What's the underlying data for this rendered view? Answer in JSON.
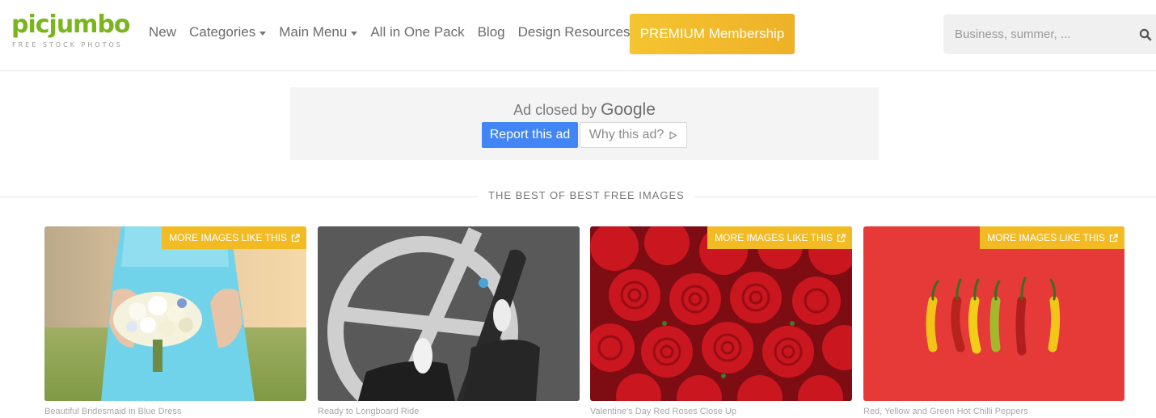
{
  "brand": {
    "name": "picjumbo",
    "tagline": "FREE STOCK PHOTOS",
    "color": "#7ab51d"
  },
  "nav": {
    "items": [
      {
        "label": "New",
        "has_caret": false
      },
      {
        "label": "Categories",
        "has_caret": true
      },
      {
        "label": "Main Menu",
        "has_caret": true
      },
      {
        "label": "All in One Pack",
        "has_caret": false
      },
      {
        "label": "Blog",
        "has_caret": false
      },
      {
        "label": "Design Resources",
        "has_caret": false
      }
    ],
    "premium_label": "PREMIUM Membership",
    "premium_color": "#f2bb24"
  },
  "search": {
    "placeholder": "Business, summer, ...",
    "value": "",
    "icon": "search-icon"
  },
  "ad": {
    "closed_text": "Ad closed by",
    "closed_brand": "Google",
    "report_label": "Report this ad",
    "why_label": "Why this ad?",
    "report_color": "#4285f4"
  },
  "section": {
    "title": "THE BEST OF BEST FREE IMAGES"
  },
  "gallery": {
    "badge_label": "MORE IMAGES LIKE THIS",
    "items": [
      {
        "caption": "Beautiful Bridesmaid in Blue Dress",
        "has_badge": true
      },
      {
        "caption": "Ready to Longboard Ride",
        "has_badge": false
      },
      {
        "caption": "Valentine's Day Red Roses Close Up",
        "has_badge": true
      },
      {
        "caption": "Red, Yellow and Green Hot Chilli Peppers",
        "has_badge": true
      }
    ]
  }
}
